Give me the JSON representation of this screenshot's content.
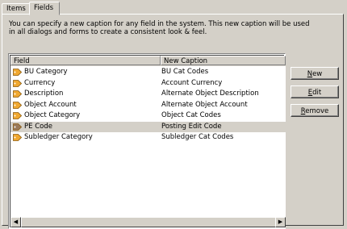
{
  "tabs": [
    {
      "label": "Items"
    },
    {
      "label": "Fields"
    }
  ],
  "description": "You can specify a new caption for any field in the system. This new caption will be used in all dialogs and forms to create a consistent look & feel.",
  "columns": {
    "field": "Field",
    "caption": "New Caption"
  },
  "rows": [
    {
      "field": "BU Category",
      "caption": "BU Cat Codes"
    },
    {
      "field": "Currency",
      "caption": "Account Currency"
    },
    {
      "field": "Description",
      "caption": "Alternate Object Description"
    },
    {
      "field": "Object Account",
      "caption": "Alternate Object Account"
    },
    {
      "field": "Object Category",
      "caption": "Object Cat Codes"
    },
    {
      "field": "PE Code",
      "caption": "Posting Edit Code"
    },
    {
      "field": "Subledger Category",
      "caption": "Subledger Cat Codes"
    }
  ],
  "selected_row": 5,
  "buttons": {
    "new": "New",
    "edit": "Edit",
    "remove": "Remove"
  },
  "colors": {
    "tag_icon": "#f0a830",
    "tag_icon_selected": "#9a7a5a"
  }
}
